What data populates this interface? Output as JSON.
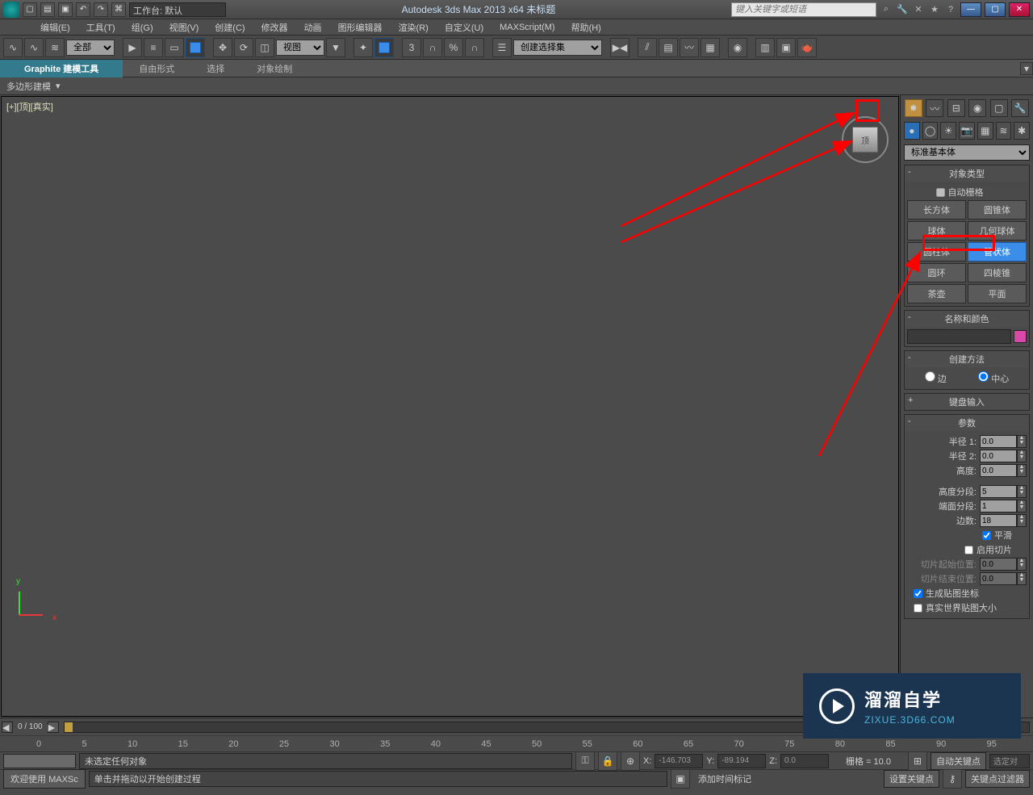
{
  "titlebar": {
    "app_title": "Autodesk 3ds Max  2013 x64     未标题",
    "workspace_prefix": "工作台:",
    "workspace_value": "默认",
    "search_placeholder": "键入关键字或短语"
  },
  "menu": {
    "items": [
      "编辑(E)",
      "工具(T)",
      "组(G)",
      "视图(V)",
      "创建(C)",
      "修改器",
      "动画",
      "图形编辑器",
      "渲染(R)",
      "自定义(U)",
      "MAXScript(M)",
      "帮助(H)"
    ]
  },
  "toolbar": {
    "sel_filter": "全部",
    "view_combo": "视图",
    "named_sel": "创建选择集"
  },
  "ribbon": {
    "tabs": [
      "Graphite 建模工具",
      "自由形式",
      "选择",
      "对象绘制"
    ],
    "sub": "多边形建模"
  },
  "viewport": {
    "label": "[+][顶][真实]",
    "cube": "顶",
    "axis_y": "y",
    "axis_x": "x"
  },
  "create": {
    "dropdown": "标准基本体",
    "roll_objtype": "对象类型",
    "auto_grid": "自动栅格",
    "buttons": [
      [
        "长方体",
        "圆锥体"
      ],
      [
        "球体",
        "几何球体"
      ],
      [
        "圆柱体",
        "管状体"
      ],
      [
        "圆环",
        "四棱锥"
      ],
      [
        "茶壶",
        "平面"
      ]
    ],
    "roll_name": "名称和颜色",
    "roll_method": "创建方法",
    "radio_edge": "边",
    "radio_center": "中心",
    "roll_kb": "键盘输入",
    "roll_params": "参数",
    "radius1": "半径 1:",
    "radius2": "半径 2:",
    "height": "高度:",
    "hseg": "高度分段:",
    "capseg": "端面分段:",
    "sides": "边数:",
    "radius1_v": "0.0",
    "radius2_v": "0.0",
    "height_v": "0.0",
    "hseg_v": "5",
    "capseg_v": "1",
    "sides_v": "18",
    "smooth": "平滑",
    "slice_on": "启用切片",
    "slice_from": "切片起始位置:",
    "slice_to": "切片结束位置:",
    "slice_v": "0.0",
    "gen_uv": "生成贴图坐标",
    "real_world": "真实世界贴图大小"
  },
  "time": {
    "frame_range": "0 / 100",
    "ticks": [
      "0",
      "5",
      "10",
      "15",
      "20",
      "25",
      "30",
      "35",
      "40",
      "45",
      "50",
      "55",
      "60",
      "65",
      "70",
      "75",
      "80",
      "85",
      "90",
      "95"
    ]
  },
  "status": {
    "none_selected": "未选定任何对象",
    "x_lbl": "X:",
    "x_val": "-146.703",
    "y_lbl": "Y:",
    "y_val": "-89.194",
    "z_lbl": "Z:",
    "z_val": "0.0",
    "grid": "栅格 = 10.0",
    "auto_key": "自动关键点",
    "sel_set": "选定对",
    "set_key": "设置关键点",
    "key_filter": "关键点过滤器",
    "prompt": "单击并拖动以开始创建过程",
    "add_time_tag": "添加时间标记",
    "welcome": "欢迎使用",
    "maxscript": "MAXSc"
  },
  "watermark": {
    "cn": "溜溜自学",
    "en": "ZIXUE.3D66.COM"
  }
}
